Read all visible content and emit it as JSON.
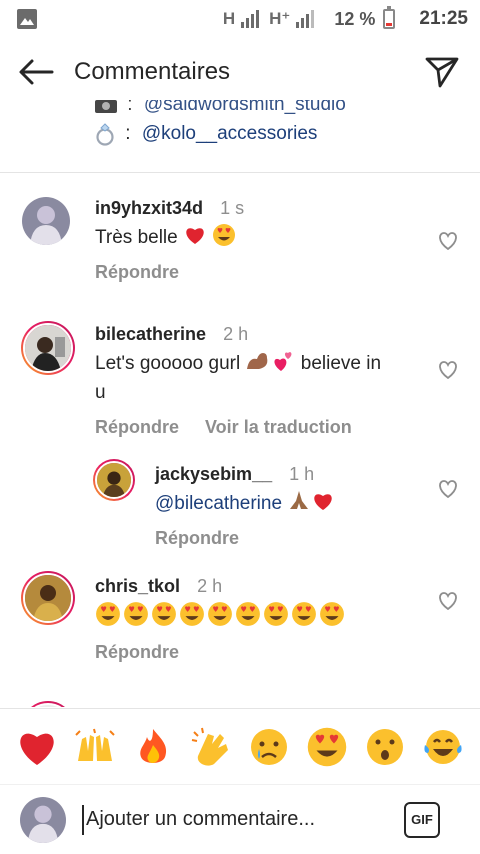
{
  "status_bar": {
    "net1": "H",
    "net2": "H⁺",
    "battery_pct": "12 %",
    "time": "21:25"
  },
  "header": {
    "title": "Commentaires",
    "back_icon": "arrow-left-icon",
    "share_icon": "paper-plane-icon"
  },
  "caption": {
    "line1_sep": ":",
    "line1_text": "@saidwordsmith_studio",
    "line2_sep": ":",
    "line2_text": "@kolo__accessories"
  },
  "comments": [
    {
      "user": "in9yhzxit34d",
      "time": "1 s",
      "text": "Très belle",
      "emojis": [
        "❤️",
        "😍"
      ],
      "actions": [
        "Répondre"
      ]
    },
    {
      "user": "bilecatherine",
      "time": "2 h",
      "text_a": "Let's gooooo gurl",
      "text_b": "believe in",
      "text_c": "u",
      "emojis": [
        "💪🏽",
        "💞"
      ],
      "actions": [
        "Répondre",
        "Voir la traduction"
      ]
    },
    {
      "user": "jackysebim__",
      "time": "1 h",
      "mention": "@bilecatherine",
      "emojis": [
        "🙏🏾",
        "❤️"
      ],
      "actions": [
        "Répondre"
      ]
    },
    {
      "user": "chris_tkol",
      "time": "2 h",
      "emojis": [
        "😍",
        "😍",
        "😍",
        "😍",
        "😍",
        "😍",
        "😍",
        "😍",
        "😍"
      ],
      "actions": [
        "Répondre"
      ]
    }
  ],
  "emoji_bar": [
    "heart",
    "raising-hands",
    "fire",
    "clapping-hands",
    "crying-face",
    "heart-eyes",
    "surprised-face",
    "tears-of-joy"
  ],
  "composer": {
    "placeholder": "Ajouter un commentaire...",
    "gif_label": "GIF"
  },
  "colors": {
    "mention": "#1d3f7a",
    "muted": "#8e8e8e",
    "text": "#262626",
    "story_ring_start": "#f9a825",
    "story_ring_end": "#c2185b"
  }
}
